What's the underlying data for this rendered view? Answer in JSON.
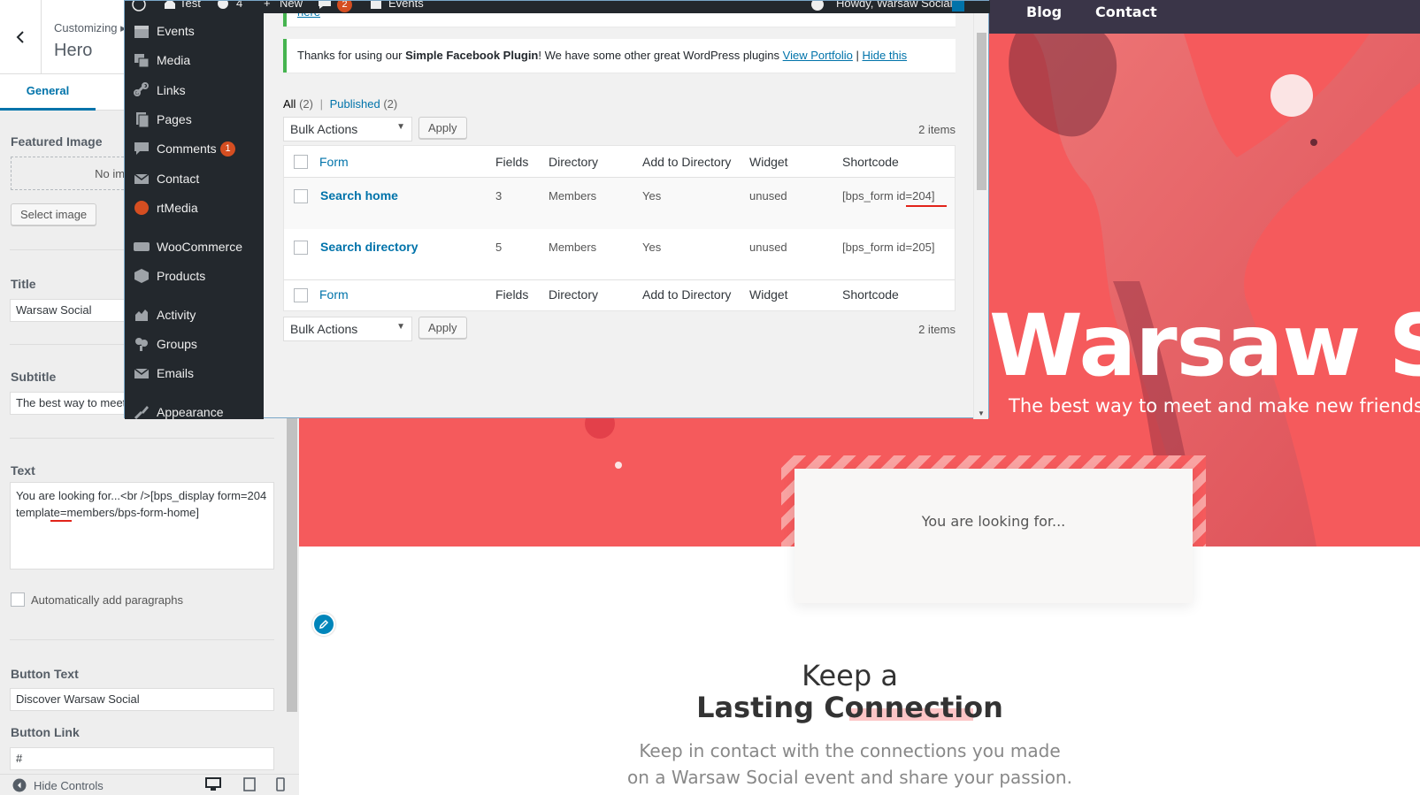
{
  "preview": {
    "nav": {
      "blog": "Blog",
      "contact": "Contact"
    },
    "hero_title": "Warsaw Social",
    "hero_subtitle": "The best way to meet and make new friends in Warsaw",
    "search_card_text": "You are looking for...",
    "section_title_1": "Keep a",
    "section_title_2": "Lasting Connection",
    "section_body_1": "Keep in contact with the connections you made",
    "section_body_2": "on a Warsaw Social event and share your passion.",
    "accent": "#f55a5c"
  },
  "customizer": {
    "crumb": "Customizing ▸ Pages",
    "title": "Hero",
    "tab_general": "General",
    "featured_image_label": "Featured Image",
    "no_image_text": "No image selected",
    "select_image_btn": "Select image",
    "title_label": "Title",
    "title_value": "Warsaw Social",
    "subtitle_label": "Subtitle",
    "subtitle_value": "The best way to meet and make new friends in Warsaw",
    "text_label": "Text",
    "text_value": "You are looking for...<br />[bps_display form=204 template=members/bps-form-home]",
    "auto_paragraphs": "Automatically add paragraphs",
    "button_text_label": "Button Text",
    "button_text_value": "Discover Warsaw Social",
    "button_link_label": "Button Link",
    "button_link_value": "#",
    "hide_controls": "Hide Controls"
  },
  "admin": {
    "bar": {
      "site": "Test",
      "updates": "4",
      "new": "New",
      "comments": "2",
      "events": "Events",
      "howdy": "Howdy, Warsaw Social"
    },
    "menu": [
      {
        "label": "Events",
        "icon": "calendar-icon"
      },
      {
        "label": "Media",
        "icon": "media-icon"
      },
      {
        "label": "Links",
        "icon": "link-icon"
      },
      {
        "label": "Pages",
        "icon": "pages-icon"
      },
      {
        "label": "Comments",
        "icon": "comment-icon",
        "badge": "1"
      },
      {
        "label": "Contact",
        "icon": "mail-icon"
      },
      {
        "label": "rtMedia",
        "icon": "rtmedia-icon"
      },
      {
        "label": "WooCommerce",
        "icon": "woo-icon"
      },
      {
        "label": "Products",
        "icon": "box-icon"
      },
      {
        "label": "Activity",
        "icon": "activity-icon"
      },
      {
        "label": "Groups",
        "icon": "groups-icon"
      },
      {
        "label": "Emails",
        "icon": "mail-icon"
      },
      {
        "label": "Appearance",
        "icon": "brush-icon"
      }
    ],
    "prev_notice_link": "here",
    "notice_pre": "Thanks for using our ",
    "notice_bold": "Simple Facebook Plugin",
    "notice_mid": "! We have some other great WordPress plugins ",
    "notice_link1": "View Portfolio",
    "notice_sep": " | ",
    "notice_link2": "Hide this",
    "filter_all": "All",
    "filter_all_count": "(2)",
    "filter_sep": "|",
    "filter_published": "Published",
    "filter_published_count": "(2)",
    "bulk_actions": "Bulk Actions",
    "apply": "Apply",
    "items_count": "2 items",
    "columns": [
      "Form",
      "Fields",
      "Directory",
      "Add to Directory",
      "Widget",
      "Shortcode"
    ],
    "rows": [
      {
        "form": "Search home",
        "fields": "3",
        "directory": "Members",
        "add": "Yes",
        "widget": "unused",
        "shortcode": "[bps_form id=204]"
      },
      {
        "form": "Search directory",
        "fields": "5",
        "directory": "Members",
        "add": "Yes",
        "widget": "unused",
        "shortcode": "[bps_form id=205]"
      }
    ],
    "menu_bg": "#23282d",
    "link_color": "#0073aa"
  }
}
